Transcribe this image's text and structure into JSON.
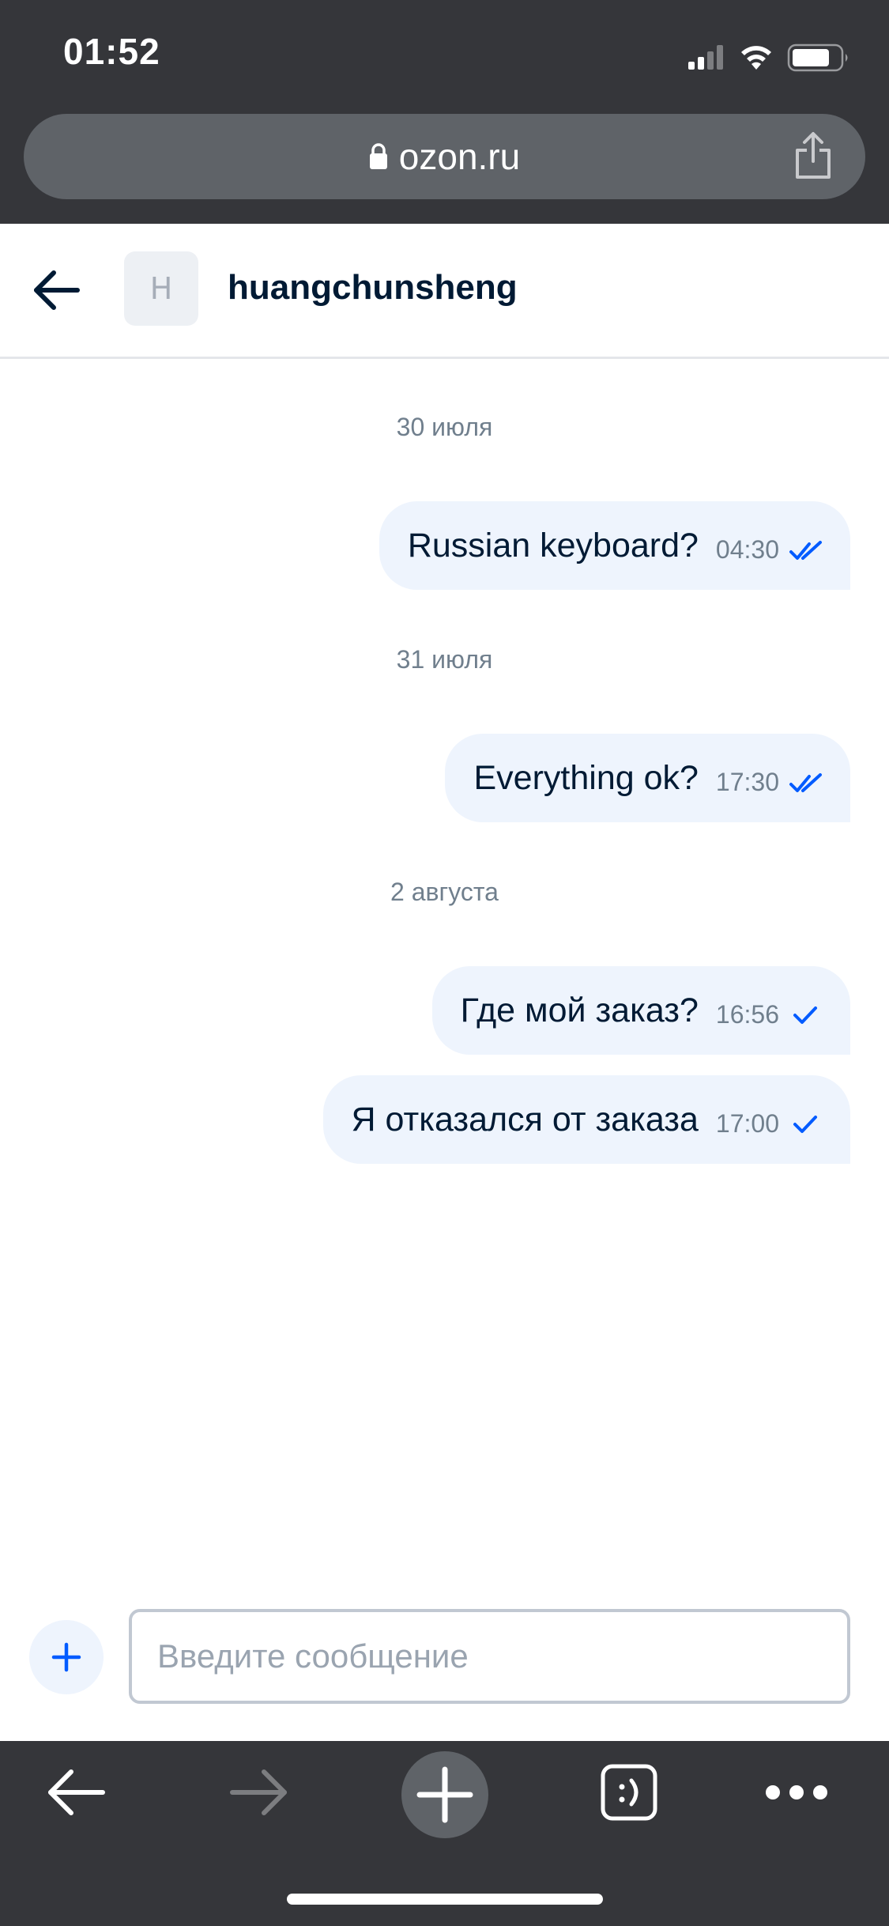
{
  "status_bar": {
    "time": "01:52"
  },
  "browser": {
    "url": "ozon.ru"
  },
  "chat": {
    "contact_initial": "H",
    "contact_name": "huangchunsheng"
  },
  "messages": [
    {
      "type": "date",
      "text": "30 июля"
    },
    {
      "type": "message",
      "text": "Russian keyboard?",
      "time": "04:30",
      "status": "read"
    },
    {
      "type": "date",
      "text": "31 июля"
    },
    {
      "type": "message",
      "text": "Everything ok?",
      "time": "17:30",
      "status": "read"
    },
    {
      "type": "date",
      "text": "2 августа"
    },
    {
      "type": "message",
      "text": "Где мой заказ?",
      "time": "16:56",
      "status": "delivered"
    },
    {
      "type": "message",
      "text": "Я отказался от заказа",
      "time": "17:00",
      "status": "delivered"
    }
  ],
  "composer": {
    "placeholder": "Введите сообщение"
  },
  "icons": {
    "status": [
      "signal-icon",
      "wifi-icon",
      "battery-icon"
    ],
    "toolbar": [
      "back-icon",
      "forward-icon",
      "new-tab-icon",
      "tabs-icon",
      "more-icon"
    ]
  },
  "colors": {
    "browser_chrome": "#35363a",
    "url_bar": "#5f6368",
    "accent_blue": "#005bff",
    "bubble": "#eef4fd",
    "text_dark": "#001a34",
    "text_muted": "#707f8d"
  }
}
